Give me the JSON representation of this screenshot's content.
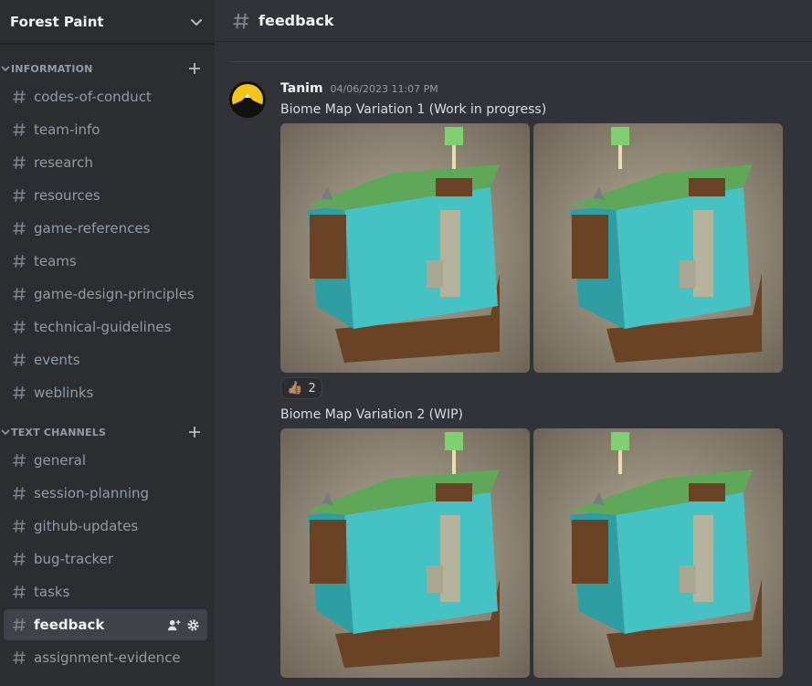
{
  "server": {
    "name": "Forest Paint"
  },
  "categories": [
    {
      "label": "INFORMATION",
      "channels": [
        {
          "label": "codes-of-conduct"
        },
        {
          "label": "team-info"
        },
        {
          "label": "research"
        },
        {
          "label": "resources"
        },
        {
          "label": "game-references"
        },
        {
          "label": "teams"
        },
        {
          "label": "game-design-principles"
        },
        {
          "label": "technical-guidelines"
        },
        {
          "label": "events"
        },
        {
          "label": "weblinks"
        }
      ]
    },
    {
      "label": "TEXT CHANNELS",
      "channels": [
        {
          "label": "general"
        },
        {
          "label": "session-planning"
        },
        {
          "label": "github-updates"
        },
        {
          "label": "bug-tracker"
        },
        {
          "label": "tasks"
        },
        {
          "label": "feedback"
        },
        {
          "label": "assignment-evidence"
        }
      ]
    }
  ],
  "channel_header": {
    "title": "feedback"
  },
  "message": {
    "author": "Tanim",
    "timestamp": "04/06/2023 11:07 PM",
    "text1": "Biome Map Variation 1 (Work in progress)",
    "text2": "Biome Map Variation 2 (WIP)",
    "reaction": {
      "emoji": "👍🏽",
      "count": "2"
    }
  },
  "colors": {
    "accent_active": "#404249",
    "water": "#45c2c4",
    "grass": "#5fa85a",
    "dirt": "#6a4325"
  }
}
